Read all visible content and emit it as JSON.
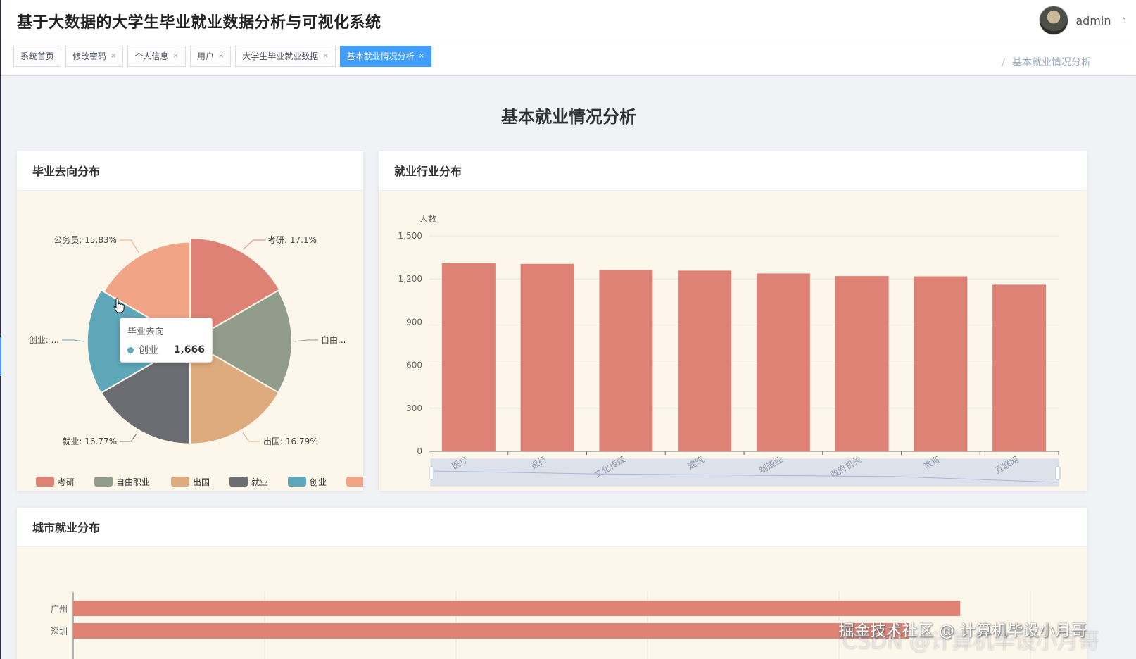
{
  "header": {
    "title": "基于大数据的大学生毕业就业数据分析与可视化系统",
    "username": "admin",
    "caret": "˅"
  },
  "tags": [
    {
      "label": "系统首页",
      "closable": false,
      "active": false
    },
    {
      "label": "修改密码",
      "closable": true,
      "active": false
    },
    {
      "label": "个人信息",
      "closable": true,
      "active": false
    },
    {
      "label": "用户",
      "closable": true,
      "active": false
    },
    {
      "label": "大学生毕业就业数据",
      "closable": true,
      "active": false
    },
    {
      "label": "基本就业情况分析",
      "closable": true,
      "active": true
    }
  ],
  "close_glyph": "×",
  "breadcrumb": {
    "separator": "/",
    "current": "基本就业情况分析"
  },
  "page": {
    "title": "基本就业情况分析"
  },
  "cards": {
    "pie_title": "毕业去向分布",
    "bar_title": "就业行业分布",
    "city_title": "城市就业分布"
  },
  "tooltip": {
    "title": "毕业去向",
    "series_label": "创业",
    "value": "1,666"
  },
  "watermark": {
    "line1": "掘金技术社区 @ 计算机毕设小月哥",
    "line2": "CSDN @计算机毕设小月哥"
  },
  "colors": {
    "accent": "#409eff",
    "bar": "#df8276",
    "card_bg": "#fdf6ea"
  },
  "chart_data": [
    {
      "type": "pie",
      "title": "毕业去向分布",
      "rose": "area",
      "categories": [
        "考研",
        "自由职业",
        "出国",
        "就业",
        "创业",
        "公务员"
      ],
      "values": [
        17.1,
        16.6,
        16.79,
        16.77,
        16.9,
        15.83
      ],
      "labels": [
        "考研: 17.1%",
        "自由...",
        "出国: 16.79%",
        "就业: 16.77%",
        "创业: ...",
        "公务员: 15.83%"
      ],
      "colors": [
        "#df8276",
        "#919c8a",
        "#ddab7d",
        "#6b6d72",
        "#5da7b9",
        "#f2a486"
      ],
      "legend_position": "bottom"
    },
    {
      "type": "bar",
      "title": "就业行业分布",
      "ylabel": "人数",
      "categories": [
        "医疗",
        "银行",
        "文化传媒",
        "建筑",
        "制造业",
        "政府机关",
        "教育",
        "互联网"
      ],
      "values": [
        1310,
        1305,
        1262,
        1258,
        1238,
        1220,
        1218,
        1160
      ],
      "ylim": [
        0,
        1500
      ],
      "yticks": [
        "0",
        "300",
        "600",
        "900",
        "1,200",
        "1,500"
      ],
      "grid": true,
      "datazoom": true
    },
    {
      "type": "bar",
      "orientation": "horizontal",
      "title": "城市就业分布",
      "categories": [
        "广州",
        "深圳"
      ],
      "values": [
        1390,
        1310
      ],
      "xlim": [
        0,
        1500
      ],
      "grid": true
    }
  ]
}
